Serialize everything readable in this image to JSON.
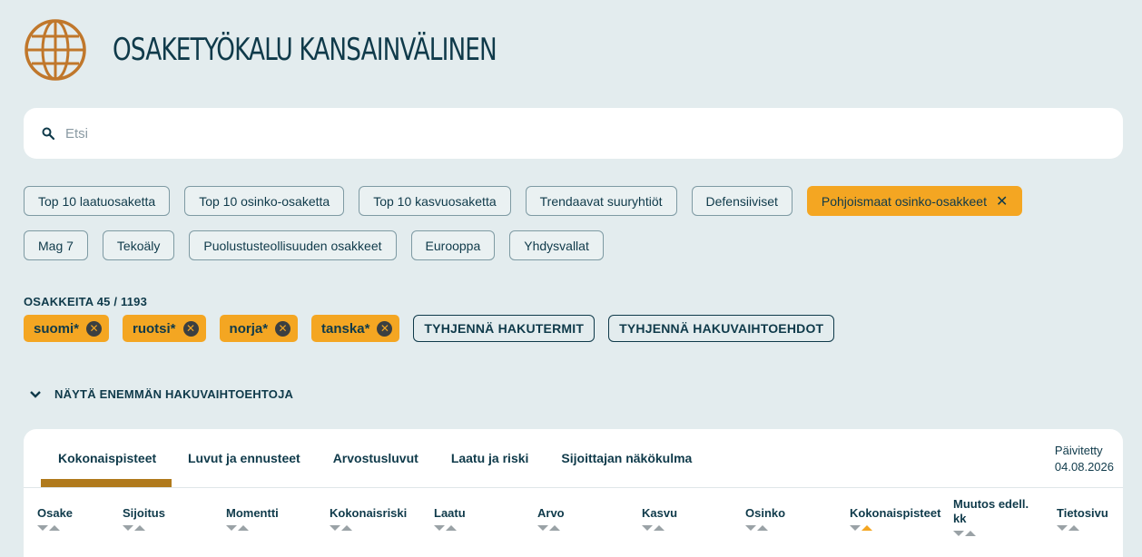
{
  "app": {
    "title": "OSAKETYÖKALU KANSAINVÄLINEN"
  },
  "search": {
    "placeholder": "Etsi"
  },
  "colors": {
    "accent": "#f4a622",
    "text": "#0f3a4a",
    "tab_underline": "#b07a1c",
    "background": "#e3ecee"
  },
  "presets": {
    "row1": [
      {
        "label": "Top 10 laatuosaketta"
      },
      {
        "label": "Top 10 osinko-osaketta"
      },
      {
        "label": "Top 10 kasvuosaketta"
      },
      {
        "label": "Trendaavat suuryhtiöt"
      },
      {
        "label": "Defensiiviset"
      },
      {
        "label": "Pohjoismaat osinko-osakkeet",
        "active": true
      }
    ],
    "row2": [
      {
        "label": "Mag 7"
      },
      {
        "label": "Tekoäly"
      },
      {
        "label": "Puolustusteollisuuden osakkeet"
      },
      {
        "label": "Eurooppa"
      },
      {
        "label": "Yhdysvallat"
      }
    ],
    "close_glyph": "✕"
  },
  "results": {
    "count_label": "OSAKKEITA 45 / 1193"
  },
  "search_terms": {
    "tags": [
      "suomi*",
      "ruotsi*",
      "norja*",
      "tanska*"
    ],
    "remove_glyph": "✕",
    "clear_terms": "TYHJENNÄ HAKUTERMIT",
    "clear_options": "TYHJENNÄ HAKUVAIHTOEHDOT"
  },
  "more_options": {
    "label": "NÄYTÄ ENEMMÄN HAKUVAIHTOEHTOJA"
  },
  "table": {
    "tabs": [
      "Kokonaispisteet",
      "Luvut ja ennusteet",
      "Arvostusluvut",
      "Laatu ja riski",
      "Sijoittajan näkökulma"
    ],
    "active_tab": "Kokonaispisteet",
    "updated_label": "Päivitetty",
    "updated_date": "04.08.2026",
    "columns": [
      "Osake",
      "Sijoitus",
      "Momentti",
      "Kokonaisriski",
      "Laatu",
      "Arvo",
      "Kasvu",
      "Osinko",
      "Kokonaispisteet",
      "Muutos edell. kk",
      "Tietosivu"
    ],
    "sorted_column": "Kokonaispisteet"
  }
}
